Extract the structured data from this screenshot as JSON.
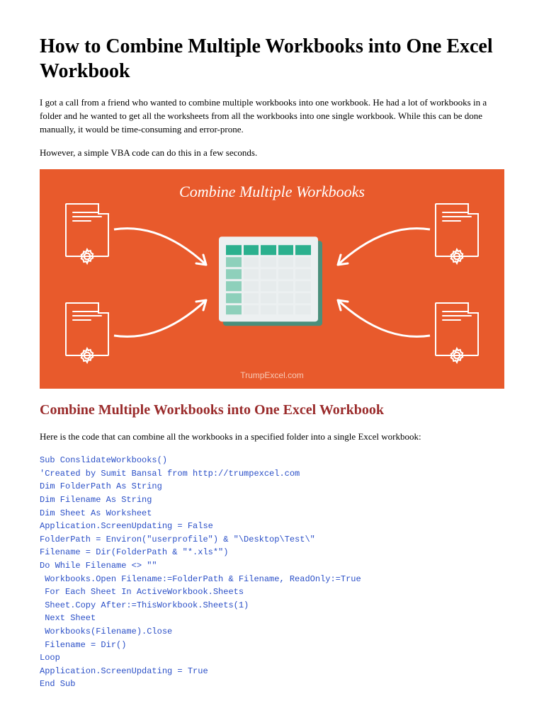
{
  "title": "How to Combine Multiple Workbooks into One Excel Workbook",
  "intro1": "I got a call from a friend who wanted to combine multiple workbooks into one workbook. He had a lot of workbooks in a folder and he wanted to get all the worksheets from all the workbooks into one single workbook. While this can be done manually, it would be time-consuming and error-prone.",
  "intro2": "However, a simple VBA code can do this in a few seconds.",
  "hero": {
    "title": "Combine Multiple Workbooks",
    "footer": "TrumpExcel.com"
  },
  "section_heading": "Combine Multiple Workbooks into One Excel Workbook",
  "section_intro": "Here is the code that can combine all the workbooks in a specified folder into a single Excel workbook:",
  "code_lines": [
    "Sub ConslidateWorkbooks()",
    "'Created by Sumit Bansal from http://trumpexcel.com",
    "Dim FolderPath As String",
    "Dim Filename As String",
    "Dim Sheet As Worksheet",
    "Application.ScreenUpdating = False",
    "FolderPath = Environ(\"userprofile\") & \"\\Desktop\\Test\\\"",
    "Filename = Dir(FolderPath & \"*.xls*\")",
    "Do While Filename <> \"\"",
    " Workbooks.Open Filename:=FolderPath & Filename, ReadOnly:=True",
    " For Each Sheet In ActiveWorkbook.Sheets",
    " Sheet.Copy After:=ThisWorkbook.Sheets(1)",
    " Next Sheet",
    " Workbooks(Filename).Close",
    " Filename = Dir()",
    "Loop",
    "Application.ScreenUpdating = True",
    "End Sub"
  ]
}
